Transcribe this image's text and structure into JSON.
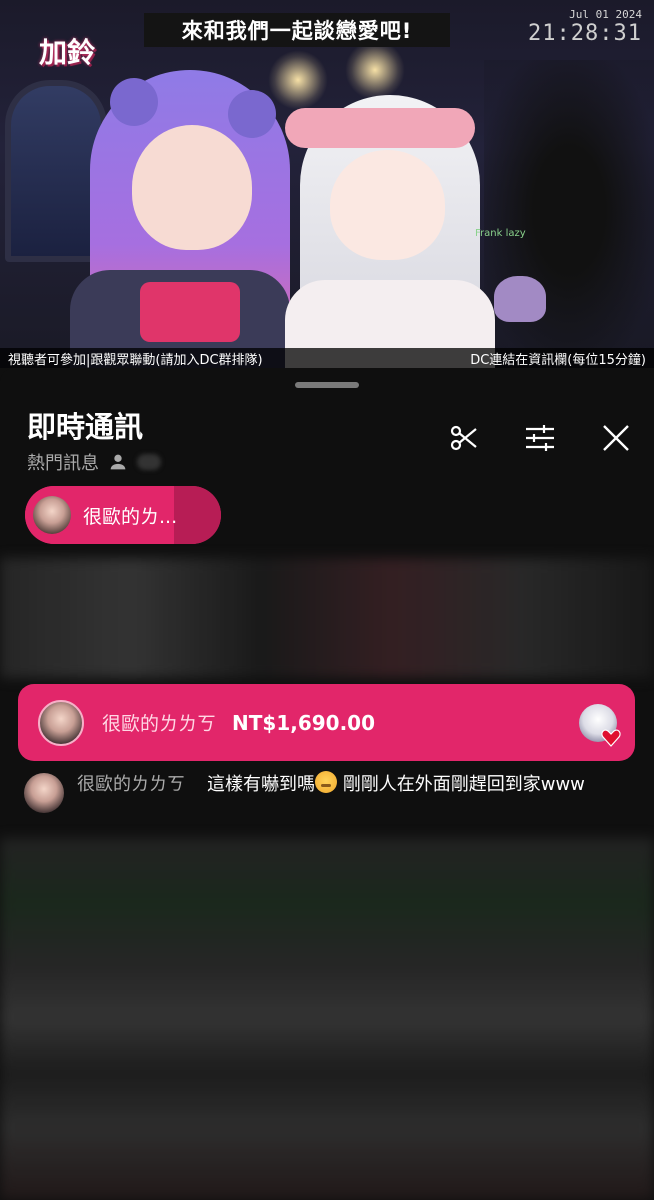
{
  "video": {
    "banner_text": "來和我們一起談戀愛吧!",
    "date": "Jul 01 2024",
    "time": "21:28:31",
    "logo_text": "加鈴",
    "mini_chat_name": "Frank lazy",
    "subtitle_left": "視聽者可參加|跟觀眾聯動(請加入DC群排隊)",
    "subtitle_right": "DC連結在資訊欄(每位15分鐘)"
  },
  "panel": {
    "title": "即時通訊",
    "subtitle": "熱門訊息",
    "icons": [
      "clip-icon",
      "tune-icon",
      "close-icon"
    ]
  },
  "pinned_chip": {
    "label": "很歐的ㄌ...",
    "progress_percent": 76
  },
  "super_chat": {
    "author": "很歐的ㄌㄌㄎ",
    "amount": "NT$1,690.00"
  },
  "message": {
    "author": "很歐的ㄌㄌㄎ",
    "text_before_emoji": "這樣有嚇到嗎",
    "text_after_emoji": " 剛剛人在外面剛趕回到家www"
  },
  "colors": {
    "accent": "#e2266a",
    "accent_dark": "#b71d55",
    "background": "#0f0f0f",
    "muted_text": "#aaaaaa"
  }
}
